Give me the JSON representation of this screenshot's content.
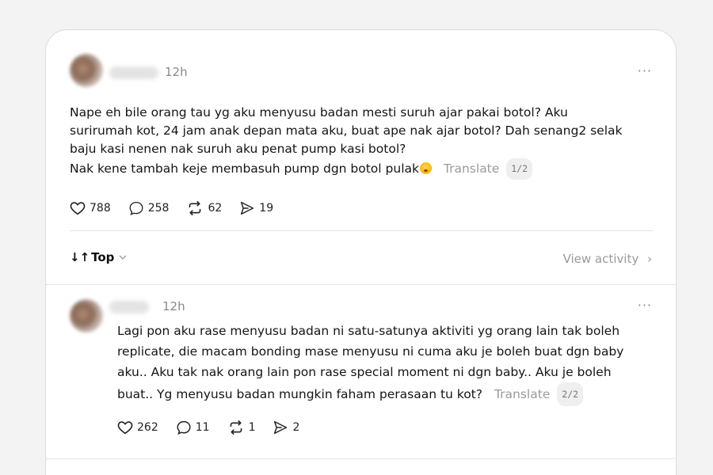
{
  "post": {
    "time": "12h",
    "more_label": "···",
    "lines": [
      "Nape eh bile orang tau yg aku menyusu badan mesti suruh ajar pakai botol? Aku",
      "surirumah kot, 24 jam anak depan mata aku, buat ape nak ajar botol? Dah senang2 selak",
      "baju kasi nenen nak suruh aku penat pump kasi botol?"
    ],
    "last_line": "Nak kene tambah keje membasuh pump dgn botol pulak",
    "emoji_icon": "face-with-rolling-eyes-emoji",
    "translate_label": "Translate",
    "page_indicator": "1/2",
    "likes": "788",
    "comments": "258",
    "reposts": "62",
    "shares": "19"
  },
  "sort": {
    "arrows": "↓↑",
    "label": "Top",
    "view_activity": "View activity",
    "chevron": "›"
  },
  "reply": {
    "time": "12h",
    "more_label": "···",
    "lines": [
      "Lagi pon aku rase menyusu badan ni satu-satunya aktiviti yg orang lain tak boleh",
      "replicate, die macam bonding mase menyusu ni cuma aku je boleh buat dgn baby",
      "aku.. Aku tak nak orang lain pon rase special moment ni dgn baby.. Aku je boleh"
    ],
    "last_line": "buat.. Yg menyusu badan mungkin faham perasaan tu kot?",
    "translate_label": "Translate",
    "page_indicator": "2/2",
    "likes": "262",
    "comments": "11",
    "reposts": "1",
    "shares": "2"
  },
  "colors": {
    "background": "#f3f3f3",
    "card": "#ffffff",
    "muted_text": "#9a9a9a",
    "text": "#141414"
  }
}
